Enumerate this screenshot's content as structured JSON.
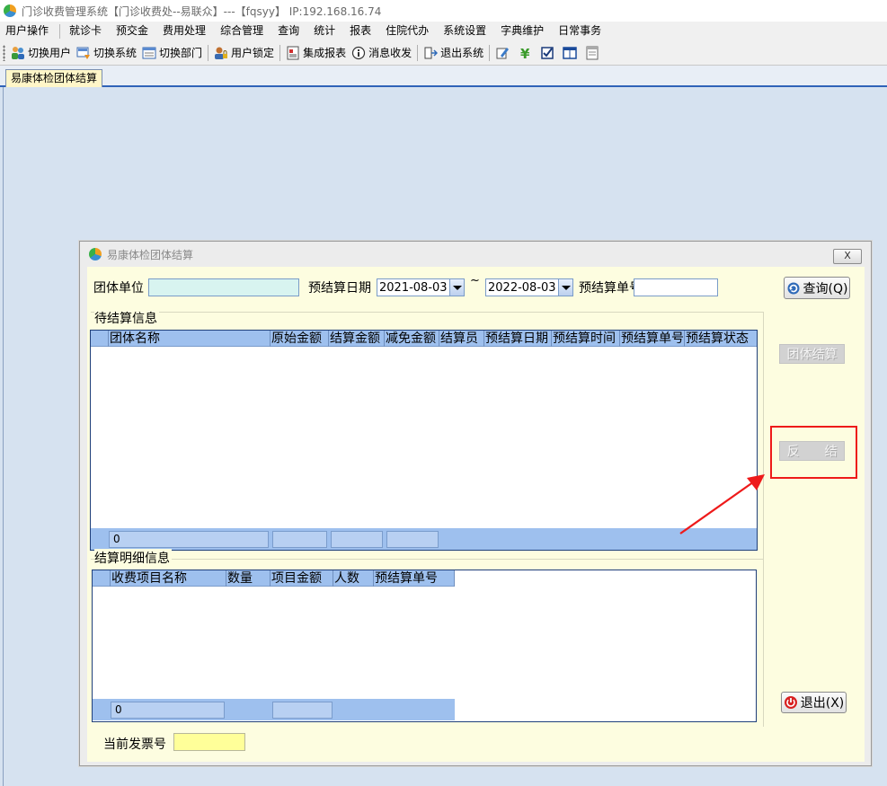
{
  "window": {
    "title": "门诊收费管理系统【门诊收费处--易联众】---【fqsyy】 IP:192.168.16.74"
  },
  "menu": [
    "用户操作",
    "就诊卡",
    "预交金",
    "费用处理",
    "综合管理",
    "查询",
    "统计",
    "报表",
    "住院代办",
    "系统设置",
    "字典维护",
    "日常事务"
  ],
  "toolbar": {
    "switch_user": "切换用户",
    "switch_system": "切换系统",
    "switch_dept": "切换部门",
    "lock_user": "用户锁定",
    "integrated_report": "集成报表",
    "messages": "消息收发",
    "exit_system": "退出系统"
  },
  "tabs": {
    "active": "易康体检团体结算"
  },
  "dialog": {
    "title": "易康体检团体结算",
    "close_label": "X",
    "group_unit_label": "团体单位",
    "group_unit_value": "",
    "date_label": "预结算日期",
    "date_from": "2021-08-03",
    "tilde": "~",
    "date_to": "2022-08-03",
    "settlement_no_label": "预结算单号",
    "settlement_no_value": "",
    "query_button": "查询(Q)",
    "group_settle_button": "团体结算",
    "reverse_button": "反　　结",
    "exit_button": "退出(X)",
    "pending": {
      "title": "待结算信息",
      "columns": [
        "团体名称",
        "原始金额",
        "结算金额",
        "减免金额",
        "结算员",
        "预结算日期",
        "预结算时间",
        "预结算单号",
        "预结算状态"
      ],
      "rows": [],
      "footer_count": "0"
    },
    "details": {
      "title": "结算明细信息",
      "columns": [
        "收费项目名称",
        "数量",
        "项目金额",
        "人数",
        "预结算单号"
      ],
      "rows": [],
      "footer_count": "0"
    },
    "invoice_label": "当前发票号",
    "invoice_value": ""
  },
  "colors": {
    "accent_red": "#ee1a1a",
    "grid_header": "#9ec0ee",
    "form_bg": "#fdfde0"
  }
}
